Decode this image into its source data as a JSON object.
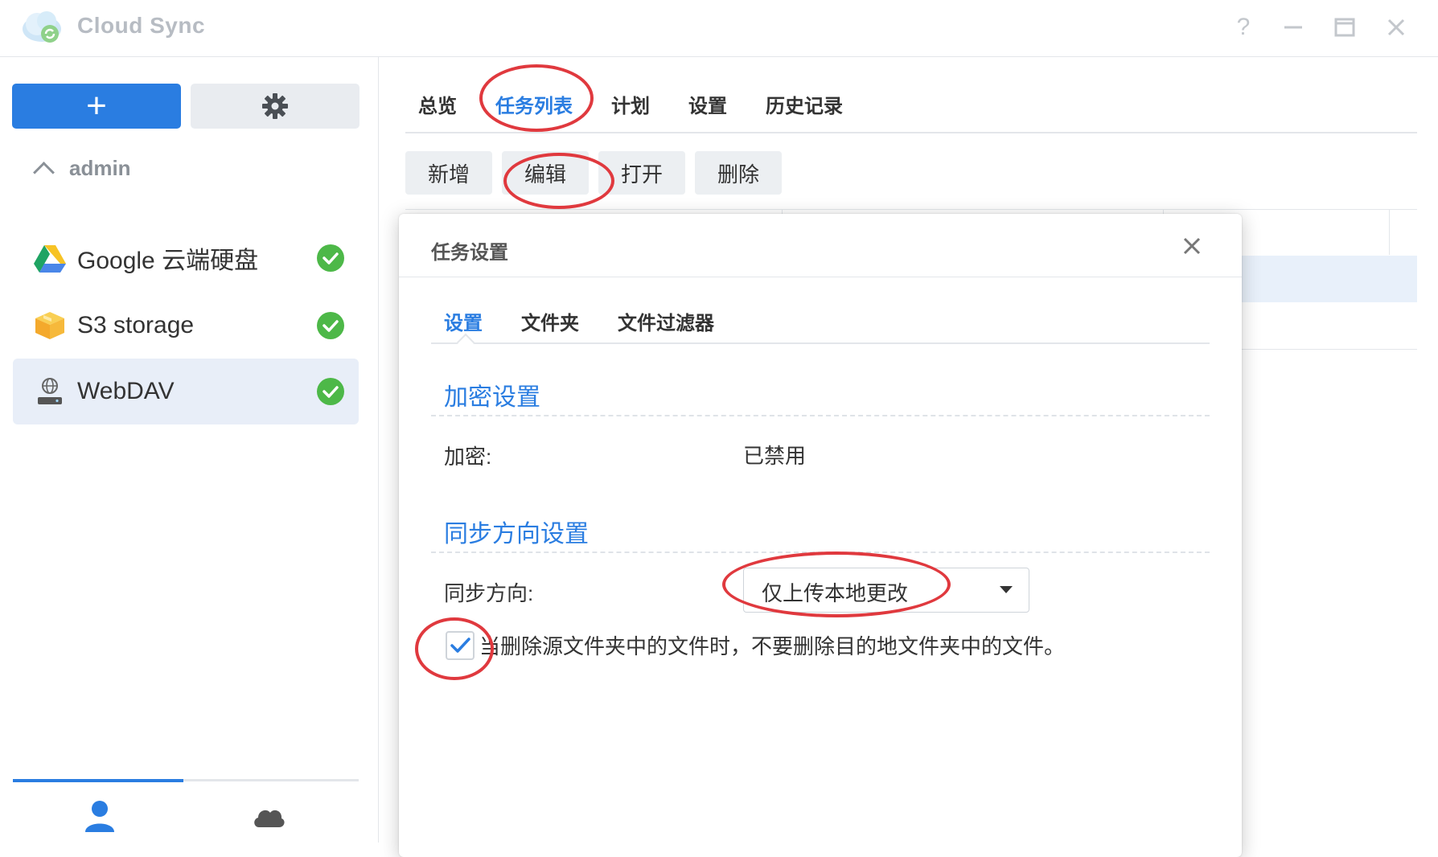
{
  "app": {
    "title": "Cloud Sync",
    "window_controls": [
      "help-icon",
      "minimize-icon",
      "maximize-icon",
      "close-icon"
    ]
  },
  "sidebar": {
    "add_button_label": "+",
    "settings_icon": "gear-icon",
    "group": {
      "label": "admin",
      "expanded": true
    },
    "items": [
      {
        "label": "Google 云端硬盘",
        "icon": "google-drive-icon",
        "status": "synced",
        "selected": false
      },
      {
        "label": "S3 storage",
        "icon": "s3-box-icon",
        "status": "synced",
        "selected": false
      },
      {
        "label": "WebDAV",
        "icon": "webdav-server-icon",
        "status": "synced",
        "selected": true
      }
    ],
    "bottom_tabs": [
      {
        "icon": "user-icon",
        "active": true
      },
      {
        "icon": "cloud-icon",
        "active": false
      }
    ]
  },
  "main": {
    "tabs": [
      {
        "label": "总览",
        "active": false
      },
      {
        "label": "任务列表",
        "active": true
      },
      {
        "label": "计划",
        "active": false
      },
      {
        "label": "设置",
        "active": false
      },
      {
        "label": "历史记录",
        "active": false
      }
    ],
    "toolbar": {
      "new_label": "新增",
      "edit_label": "编辑",
      "open_label": "打开",
      "delete_label": "删除"
    }
  },
  "dialog": {
    "title": "任务设置",
    "tabs": [
      {
        "label": "设置",
        "active": true
      },
      {
        "label": "文件夹",
        "active": false
      },
      {
        "label": "文件过滤器",
        "active": false
      }
    ],
    "encryption": {
      "section_title": "加密设置",
      "label": "加密:",
      "value": "已禁用"
    },
    "sync_direction": {
      "section_title": "同步方向设置",
      "label": "同步方向:",
      "selected": "仅上传本地更改"
    },
    "checkbox": {
      "checked": true,
      "label": "当删除源文件夹中的文件时，不要删除目的地文件夹中的文件。"
    }
  },
  "colors": {
    "accent": "#2a7de1",
    "annotation_red": "#e0393e",
    "success_green": "#4db848",
    "selected_bg": "#e8eef8"
  }
}
